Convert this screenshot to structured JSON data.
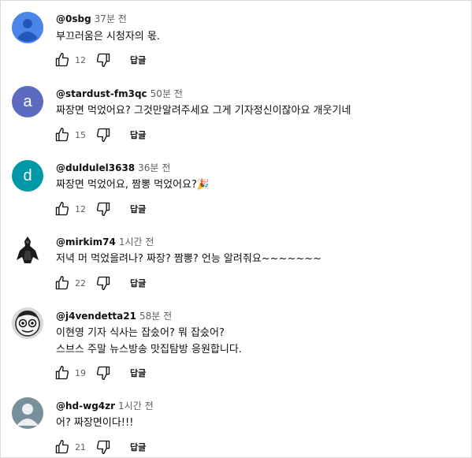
{
  "comments": [
    {
      "author": "@0sbg",
      "time": "37분 전",
      "text": [
        "부끄러움은 시청자의  몫."
      ],
      "likes": "12",
      "reply_label": "답글",
      "avatar": {
        "type": "default-user",
        "color": "#4a86e8"
      }
    },
    {
      "author": "@stardust-fm3qc",
      "time": "50분 전",
      "text": [
        "짜장면 먹었어요?  그것만알려주세요 그게 기자정신이잖아요 개웃기네"
      ],
      "likes": "15",
      "reply_label": "답글",
      "avatar": {
        "type": "letter",
        "letter": "a",
        "color": "#5c6bc0"
      }
    },
    {
      "author": "@duldulel3638",
      "time": "36분 전",
      "text": [
        "짜장면 먹었어요, 짬뽕 먹었어요?"
      ],
      "emoji": "🎉",
      "likes": "12",
      "reply_label": "답글",
      "avatar": {
        "type": "letter",
        "letter": "d",
        "color": "#0097a7"
      }
    },
    {
      "author": "@mirkim74",
      "time": "1시간 전",
      "text": [
        "저녁 머 먹었을려나?  짜장?  짬뽕?  언능 알려줘요~~~~~~~"
      ],
      "likes": "22",
      "reply_label": "답글",
      "avatar": {
        "type": "dark-figure"
      }
    },
    {
      "author": "@j4vendetta21",
      "time": "58분 전",
      "text": [
        "이현영 기자 식사는 잡숬어? 뭐 잡숬어?",
        "스브스 주말 뉴스방송 맛집탐방 응원합니다."
      ],
      "likes": "19",
      "reply_label": "답글",
      "avatar": {
        "type": "cartoon-face"
      }
    },
    {
      "author": "@hd-wg4zr",
      "time": "1시간 전",
      "text": [
        "어? 짜장면이다!!!"
      ],
      "likes": "21",
      "reply_label": "답글",
      "avatar": {
        "type": "gray-user",
        "color": "#78909c"
      }
    }
  ]
}
